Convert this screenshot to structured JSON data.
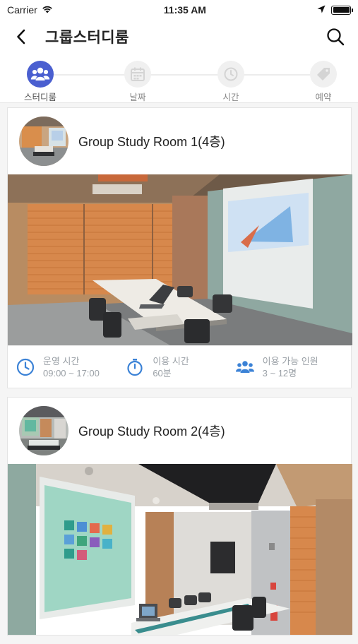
{
  "status_bar": {
    "carrier": "Carrier",
    "time": "11:35 AM"
  },
  "header": {
    "title": "그룹스터디룸"
  },
  "steps": [
    {
      "label": "스터디룸",
      "icon": "group-icon",
      "active": true
    },
    {
      "label": "날짜",
      "icon": "calendar-icon",
      "active": false
    },
    {
      "label": "시간",
      "icon": "clock-icon",
      "active": false
    },
    {
      "label": "예약",
      "icon": "tag-icon",
      "active": false
    }
  ],
  "rooms": [
    {
      "title": "Group Study Room 1(4층)",
      "info": [
        {
          "label": "운영 시간",
          "value": "09:00 ~ 17:00",
          "icon": "clock-icon"
        },
        {
          "label": "이용 시간",
          "value": "60분",
          "icon": "stopwatch-icon"
        },
        {
          "label": "이용 가능 인원",
          "value": "3 ~ 12명",
          "icon": "people-icon"
        }
      ]
    },
    {
      "title": "Group Study Room 2(4층)"
    }
  ],
  "colors": {
    "accent": "#4a5fd0",
    "info_icon": "#3b82d6"
  }
}
